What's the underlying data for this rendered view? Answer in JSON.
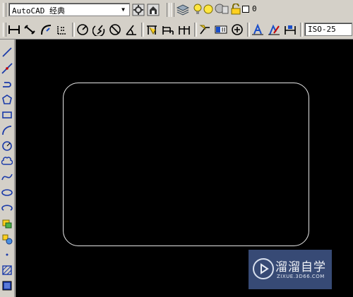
{
  "workspace": {
    "selected": "AutoCAD 经典"
  },
  "layers": {
    "current": "0"
  },
  "dimstyle": {
    "current": "ISO-25"
  },
  "watermark": {
    "name": "溜溜自学",
    "url": "ZIXUE.3D66.COM"
  },
  "icons": {
    "row1": [
      "workspace-settings-icon",
      "workspace-save-icon",
      "layer-manager-icon",
      "layer-on-icon",
      "layer-freeze-icon",
      "layer-lock-icon",
      "layer-color-icon"
    ],
    "row2": [
      "linear-dimension-icon",
      "aligned-dimension-icon",
      "arc-length-icon",
      "ordinate-dimension-icon",
      "radius-dimension-icon",
      "jogged-dimension-icon",
      "diameter-dimension-icon",
      "angular-dimension-icon",
      "quick-dimension-icon",
      "baseline-dimension-icon",
      "continue-dimension-icon",
      "quick-leader-icon",
      "tolerance-icon",
      "center-mark-icon",
      "dimension-edit-icon",
      "dimension-text-edit-icon",
      "dimension-update-icon"
    ],
    "draw": [
      "line-icon",
      "construction-line-icon",
      "polyline-icon",
      "polygon-icon",
      "rectangle-icon",
      "arc-icon",
      "circle-icon",
      "revision-cloud-icon",
      "spline-icon",
      "ellipse-icon",
      "ellipse-arc-icon",
      "insert-block-icon",
      "make-block-icon",
      "point-icon",
      "hatch-icon",
      "gradient-icon"
    ]
  },
  "colors": {
    "canvas": "#000000",
    "toolbar": "#d4d0c8",
    "geometry": "#e6e6e6",
    "watermark": "#465f96"
  }
}
